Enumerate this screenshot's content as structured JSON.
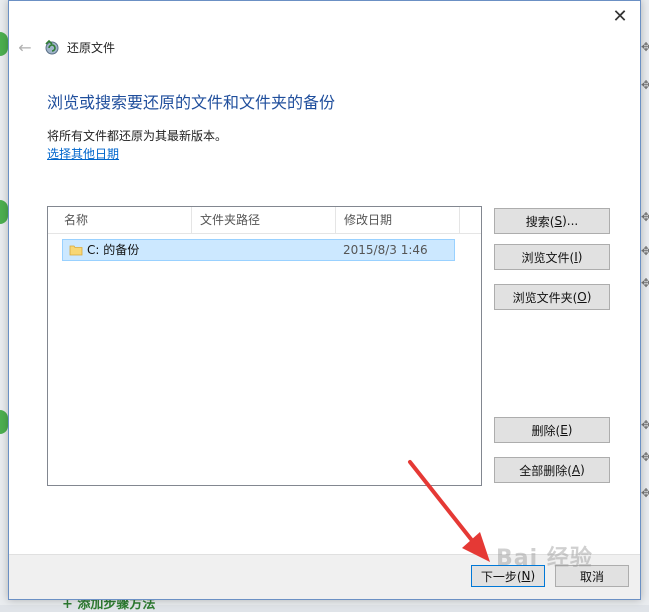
{
  "dialog": {
    "title": "还原文件",
    "heading": "浏览或搜索要还原的文件和文件夹的备份",
    "description": "将所有文件都还原为其最新版本。",
    "choose_other_date_link": "选择其他日期",
    "close_glyph": "✕",
    "back_glyph": "←"
  },
  "list": {
    "columns": [
      "名称",
      "文件夹路径",
      "修改日期"
    ],
    "rows": [
      {
        "name": "C: 的备份",
        "folder_path": "",
        "modified": "2015/8/3 1:46",
        "selected": true,
        "icon": "folder-icon"
      }
    ]
  },
  "buttons": {
    "search": {
      "text": "搜索(",
      "key": "S",
      "tail": ")..."
    },
    "browse_files": {
      "text": "浏览文件(",
      "key": "I",
      "tail": ")"
    },
    "browse_folders": {
      "text": "浏览文件夹(",
      "key": "O",
      "tail": ")"
    },
    "remove": {
      "text": "删除(",
      "key": "E",
      "tail": ")"
    },
    "remove_all": {
      "text": "全部删除(",
      "key": "A",
      "tail": ")"
    },
    "next": {
      "text": "下一步(",
      "key": "N",
      "tail": ")"
    },
    "cancel": {
      "text": "取消",
      "key": "",
      "tail": ""
    }
  },
  "background": {
    "bottom_link": "+ 添加步骤方法"
  },
  "watermark": "Bai 经验",
  "colors": {
    "accent": "#1f4e9c",
    "link": "#0066cc",
    "selection": "#cce8ff",
    "arrow": "#e53935"
  }
}
